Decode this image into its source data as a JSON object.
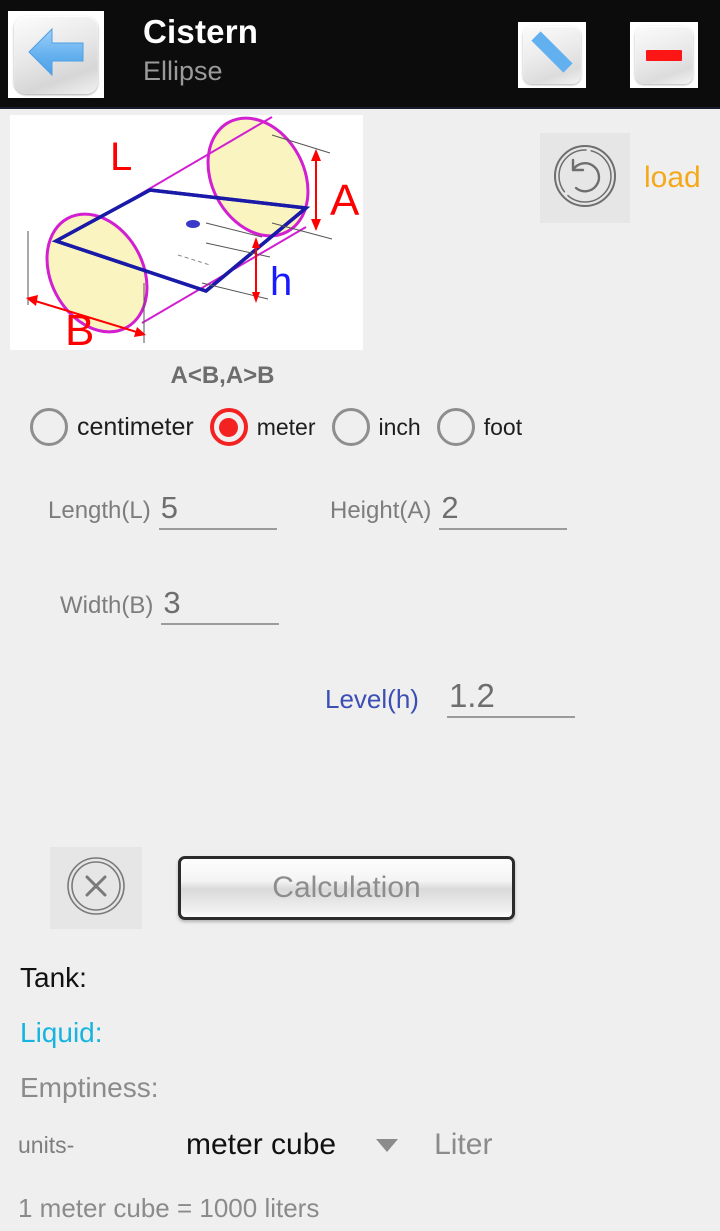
{
  "titlebar": {
    "back_icon": "back-arrow-icon",
    "title": "Cistern",
    "subtitle": "Ellipse",
    "edit_icon": "pencil-icon",
    "minus_icon": "minus-icon"
  },
  "diagram": {
    "name": "elliptical-cistern-diagram",
    "labels": {
      "length": "L",
      "height": "A",
      "width": "B",
      "level": "h"
    },
    "colors": {
      "outline": "#d11fd1",
      "inner": "#1a1aa8",
      "fill": "#faf5c0",
      "dimension": "#ff0000",
      "level": "#1a1aff"
    }
  },
  "load": {
    "icon": "restore-undo-icon",
    "label": "load",
    "color": "#f5a81c"
  },
  "constraint_note": "A<B,A>B",
  "units_radio": {
    "options": [
      {
        "label": "centimeter",
        "selected": false
      },
      {
        "label": "meter",
        "selected": true
      },
      {
        "label": "inch",
        "selected": false
      },
      {
        "label": "foot",
        "selected": false
      }
    ],
    "selected_color": "#f42121"
  },
  "fields": {
    "length": {
      "label": "Length(L)",
      "value": "5"
    },
    "height": {
      "label": "Height(A)",
      "value": "2"
    },
    "width": {
      "label": "Width(B)",
      "value": "3"
    },
    "level": {
      "label": "Level(h)",
      "value": "1.2",
      "label_color": "#3b4fb5"
    }
  },
  "actions": {
    "clear_icon": "clear-x-circle-icon",
    "calculate_label": "Calculation"
  },
  "results": {
    "tank": "Tank:",
    "liquid": "Liquid:",
    "emptiness": "Emptiness:",
    "liquid_color": "#18b4e0"
  },
  "units_row": {
    "label": "units-",
    "selected_unit": "meter cube",
    "caret_icon": "chevron-down-icon",
    "target_unit": "Liter",
    "conversion": "1 meter cube = 1000 liters"
  }
}
